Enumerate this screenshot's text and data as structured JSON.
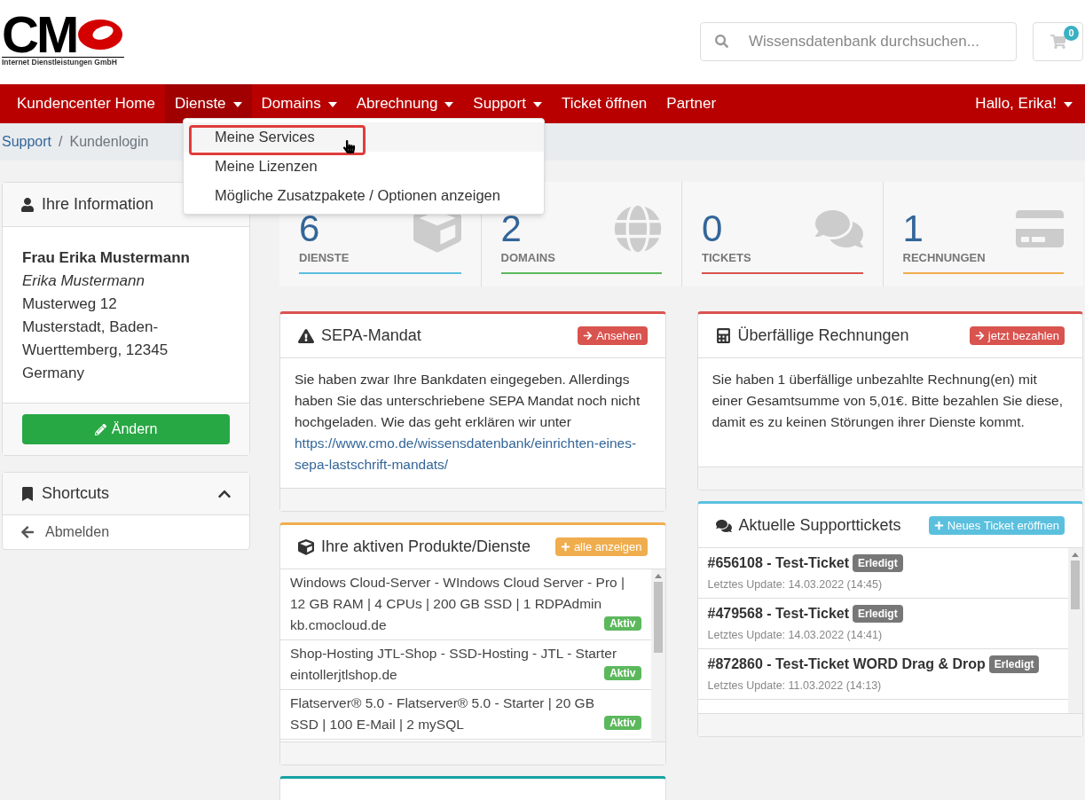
{
  "header": {
    "logo_text": "CM",
    "logo_subtitle": "Internet Dienstleistungen GmbH",
    "search": {
      "placeholder": "Wissensdatenbank durchsuchen..."
    },
    "cart": {
      "count": "0"
    }
  },
  "nav": {
    "items": [
      {
        "label": "Kundencenter Home",
        "has_caret": false,
        "selected": false
      },
      {
        "label": "Dienste",
        "has_caret": true,
        "selected": true
      },
      {
        "label": "Domains",
        "has_caret": true,
        "selected": false
      },
      {
        "label": "Abrechnung",
        "has_caret": true,
        "selected": false
      },
      {
        "label": "Support",
        "has_caret": true,
        "selected": false
      },
      {
        "label": "Ticket öffnen",
        "has_caret": false,
        "selected": false
      },
      {
        "label": "Partner",
        "has_caret": false,
        "selected": false
      }
    ],
    "user": {
      "label": "Hallo, Erika!"
    }
  },
  "dropdown": {
    "items": [
      {
        "label": "Meine Services",
        "selected": true
      },
      {
        "label": "Meine Lizenzen",
        "selected": false
      },
      {
        "label": "Mögliche Zusatzpakete / Optionen anzeigen",
        "selected": false
      }
    ]
  },
  "breadcrumb": {
    "separator": "/",
    "items": [
      {
        "label": "Support",
        "kind": "link"
      },
      {
        "label": "Kundenlogin",
        "kind": "current"
      }
    ]
  },
  "sidebar": {
    "info": {
      "title": "Ihre Information",
      "name": "Frau Erika Mustermann",
      "contact": "Erika Mustermann",
      "address": [
        "Musterweg 12",
        "Musterstadt, Baden-Wuerttemberg, 12345",
        "Germany"
      ],
      "button": "Ändern"
    },
    "shortcuts": {
      "title": "Shortcuts",
      "expanded": true,
      "items": [
        "Abmelden"
      ]
    }
  },
  "stats": [
    {
      "value": "6",
      "label": "DIENSTE",
      "color": "#5bc0de"
    },
    {
      "value": "2",
      "label": "DOMAINS",
      "color": "#5cb85c"
    },
    {
      "value": "0",
      "label": "TICKETS",
      "color": "#d9534f"
    },
    {
      "value": "1",
      "label": "RECHNUNGEN",
      "color": "#f0ad4e"
    }
  ],
  "panels": {
    "sepa": {
      "title": "SEPA-Mandat",
      "button": "Ansehen",
      "text": "Sie haben zwar Ihre Bankdaten eingegeben. Allerdings haben Sie das unterschriebene SEPA Mandat noch nicht hochgeladen. Wie das geht erklären wir unter",
      "link": "https://www.cmo.de/wissensdatenbank/einrichten-eines-sepa-lastschrift-mandats/"
    },
    "overdue": {
      "title": "Überfällige Rechnungen",
      "button": "jetzt bezahlen",
      "text": "Sie haben 1 überfällige unbezahlte Rechnung(en) mit einer Gesamtsumme von 5,01€. Bitte bezahlen Sie diese, damit es zu keinen Störungen ihrer Dienste kommt."
    },
    "products": {
      "title": "Ihre aktiven Produkte/Dienste",
      "button": "alle anzeigen",
      "items": [
        {
          "name": "Windows Cloud-Server - WIndows Cloud Server - Pro | 12 GB RAM | 4 CPUs | 200 GB SSD | 1 RDPAdmin",
          "domain": "kb.cmocloud.de",
          "status": "Aktiv"
        },
        {
          "name": "Shop-Hosting JTL-Shop - SSD-Hosting - JTL - Starter",
          "domain": "eintollerjtlshop.de",
          "status": "Aktiv"
        },
        {
          "name": "Flatserver® 5.0 - Flatserver® 5.0 - Starter | 20 GB SSD | 100 E-Mail | 2 mySQL",
          "status": "Aktiv"
        }
      ]
    },
    "tickets": {
      "title": "Aktuelle Supporttickets",
      "button": "Neues Ticket eröffnen",
      "items": [
        {
          "title": "#656108 - Test-Ticket",
          "status": "Erledigt",
          "updated": "Letztes Update: 14.03.2022 (14:45)"
        },
        {
          "title": "#479568 - Test-Ticket",
          "status": "Erledigt",
          "updated": "Letztes Update: 14.03.2022 (14:41)"
        },
        {
          "title": "#872860 - Test-Ticket WORD Drag & Drop",
          "status": "Erledigt",
          "updated": "Letztes Update: 11.03.2022 (14:13)"
        }
      ]
    }
  }
}
